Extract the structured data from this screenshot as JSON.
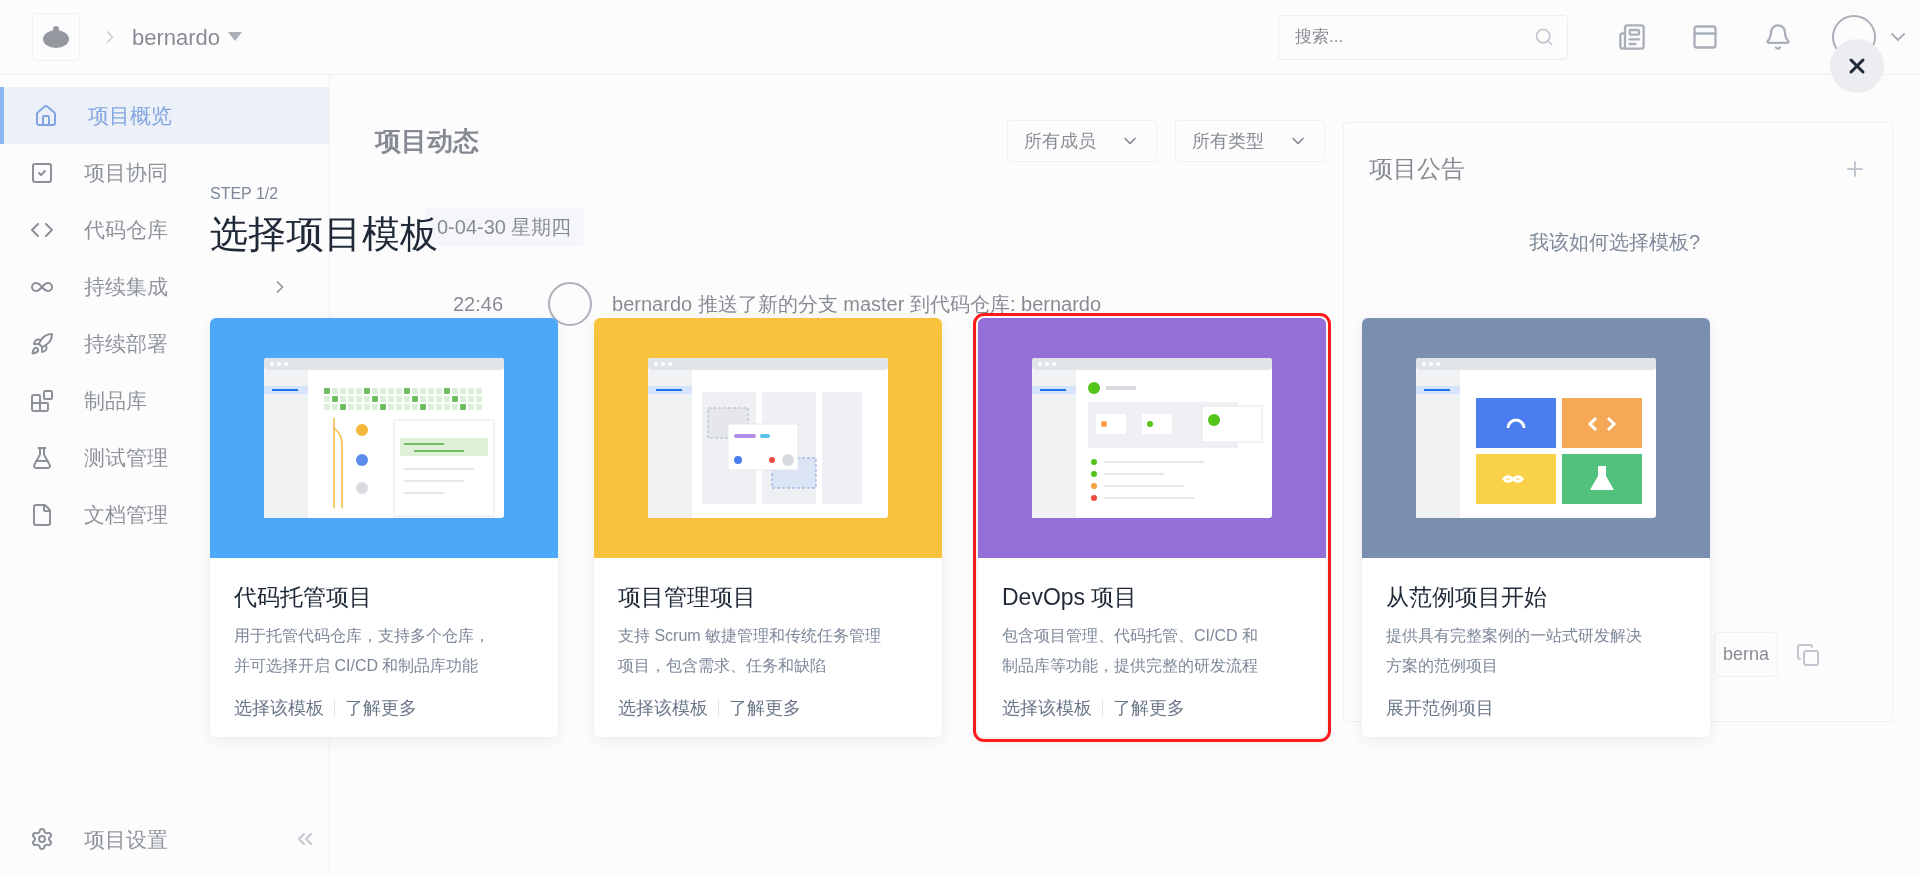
{
  "background": {
    "topbar": {
      "user": "bernardo",
      "search_placeholder": "搜索..."
    },
    "sidebar": {
      "items": [
        {
          "kind": "home",
          "label": "项目概览",
          "selected": true
        },
        {
          "kind": "check",
          "label": "项目协同",
          "selected": false
        },
        {
          "kind": "code",
          "label": "代码仓库",
          "selected": false
        },
        {
          "kind": "ci",
          "label": "持续集成",
          "selected": false
        },
        {
          "kind": "deploy",
          "label": "持续部署",
          "selected": false
        },
        {
          "kind": "artifact",
          "label": "制品库",
          "selected": false
        },
        {
          "kind": "test",
          "label": "测试管理",
          "selected": false
        },
        {
          "kind": "doc",
          "label": "文档管理",
          "selected": false
        }
      ],
      "settings": "项目设置"
    },
    "main": {
      "title": "项目动态",
      "filters": [
        "所有成员",
        "所有类型"
      ],
      "date": "0-04-30 星期四",
      "events": [
        {
          "time": "22:46",
          "text": "bernardo 推送了新的分支 master 到代码仓库: bernardo"
        }
      ]
    },
    "announcement": {
      "title": "项目公告",
      "field": "berna"
    }
  },
  "modal": {
    "step": "STEP 1/2",
    "title": "选择项目模板",
    "help_link": "我该如何选择模板?",
    "cards": [
      {
        "kind": "code",
        "color": "#4ea8f8",
        "highlighted": false,
        "title": "代码托管项目",
        "lines": [
          "用于托管代码仓库，支持多个仓库，",
          "并可选择开启 CI/CD 和制品库功能"
        ],
        "actions": [
          "选择该模板",
          "了解更多"
        ]
      },
      {
        "kind": "pm",
        "color": "#f9c23d",
        "highlighted": false,
        "title": "项目管理项目",
        "lines": [
          "支持 Scrum 敏捷管理和传统任务管理",
          "项目，包含需求、任务和缺陷"
        ],
        "actions": [
          "选择该模板",
          "了解更多"
        ]
      },
      {
        "kind": "devops",
        "color": "#9370d8",
        "highlighted": true,
        "title": "DevOps 项目",
        "lines": [
          "包含项目管理、代码托管、CI/CD 和",
          "制品库等功能，提供完整的研发流程"
        ],
        "actions": [
          "选择该模板",
          "了解更多"
        ]
      },
      {
        "kind": "demo",
        "color": "#7b8fb0",
        "highlighted": false,
        "title": "从范例项目开始",
        "lines": [
          "提供具有完整案例的一站式研发解决",
          "方案的范例项目"
        ],
        "actions": [
          "展开范例项目"
        ]
      }
    ]
  }
}
